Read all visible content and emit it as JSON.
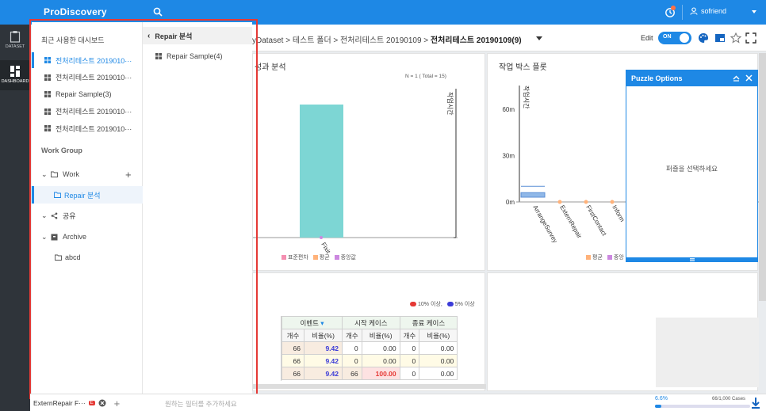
{
  "app": {
    "logo": "ProDiscovery",
    "user": "sofriend"
  },
  "rail": {
    "items": [
      {
        "label": "DATASET"
      },
      {
        "label": "DASHBOARD"
      }
    ]
  },
  "breadcrumb": {
    "path": "yDataset  >  테스트 폴더  >  전처리테스트 20190109  > ",
    "current": "전처리테스트 20190109(9)"
  },
  "toolbar": {
    "edit_label": "Edit",
    "toggle_label": "ON"
  },
  "nav": {
    "recent_title": "최근 사용한 대시보드",
    "recent": [
      "전처리테스트 2019010···",
      "전처리테스트 2019010···",
      "Repair Sample(3)",
      "전처리테스트 2019010···",
      "전처리테스트 2019010···"
    ],
    "work_group_title": "Work Group",
    "work_label": "Work",
    "work_child": "Repair 분석",
    "share_label": "공유",
    "archive_label": "Archive",
    "archive_child": "abcd",
    "sub_title": "Repair 분석",
    "sub_items": [
      "Repair Sample(4)"
    ]
  },
  "panel1": {
    "title": "성과 분석",
    "n_label": "N = 1 ( Total = 15)",
    "axis_right_label": "작업시간",
    "legend": [
      "표준편차",
      "평균",
      "중앙값"
    ],
    "colors": {
      "bar": "#7dd6d4",
      "std": "#f48fb1",
      "mean": "#ffb27a",
      "median": "#cc88e0"
    }
  },
  "panel2": {
    "title": "작업 박스 플롯",
    "axis_label": "작업시간",
    "legend": [
      "평균",
      "중앙"
    ]
  },
  "chart_data": [
    {
      "type": "bar",
      "categories": [
        "Fixit"
      ],
      "values": [
        1
      ],
      "ylabel": "작업시간",
      "legend": [
        "표준편차",
        "평균",
        "중앙값"
      ]
    },
    {
      "type": "scatter",
      "categories": [
        "ArrangeSurvey",
        "ExternRepair",
        "FirstContact",
        "Inform"
      ],
      "y_ticks": [
        "0m",
        "30m",
        "60m"
      ],
      "ylim": [
        0,
        70
      ],
      "values": [
        5,
        0,
        0,
        0
      ],
      "ylabel": "작업시간",
      "legend": [
        "평균",
        "중앙"
      ]
    }
  ],
  "table": {
    "legend": [
      "10% 이상,",
      "5% 이상"
    ],
    "groups": [
      "이벤트",
      "시작 케이스",
      "종료 케이스"
    ],
    "sub": [
      "개수",
      "비율(%)",
      "개수",
      "비율(%)",
      "개수",
      "비율(%)"
    ],
    "rows": [
      [
        "66",
        "9.42",
        "0",
        "0.00",
        "0",
        "0.00"
      ],
      [
        "66",
        "9.42",
        "0",
        "0.00",
        "0",
        "0.00"
      ],
      [
        "66",
        "9.42",
        "66",
        "100.00",
        "0",
        "0.00"
      ]
    ]
  },
  "puzzle": {
    "title": "Puzzle Options",
    "message": "퍼즐을 선택하세요"
  },
  "statusbar": {
    "filter_chip": "ExternRepair F···",
    "chip_badge": "E",
    "filter_placeholder": "원하는 필터를 추가하세요",
    "progress_label": "6.6%",
    "progress_value": 6.6,
    "cases_label": "66/1,000 Cases"
  }
}
